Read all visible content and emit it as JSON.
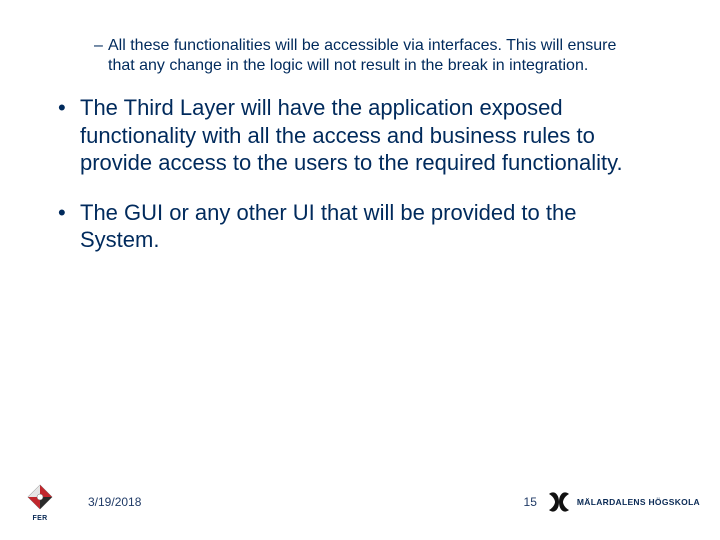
{
  "content": {
    "sub_bullet_marker": "–",
    "main_bullet_marker": "•",
    "sub_bullet": "All these functionalities will be accessible via interfaces. This will ensure that any change in the logic will not result in the break in integration.",
    "main_bullet_1": "The Third Layer will have the application exposed functionality with all the access and business rules to provide access to the users to the required functionality.",
    "main_bullet_2": "The GUI or any other UI that will be provided to the System."
  },
  "footer": {
    "date": "3/19/2018",
    "page_number": "15",
    "left_logo_label": "FER",
    "right_logo_label": "MÄLARDALENS HÖGSKOLA"
  },
  "colors": {
    "text": "#002a5c",
    "accent": "#0a2a55"
  }
}
